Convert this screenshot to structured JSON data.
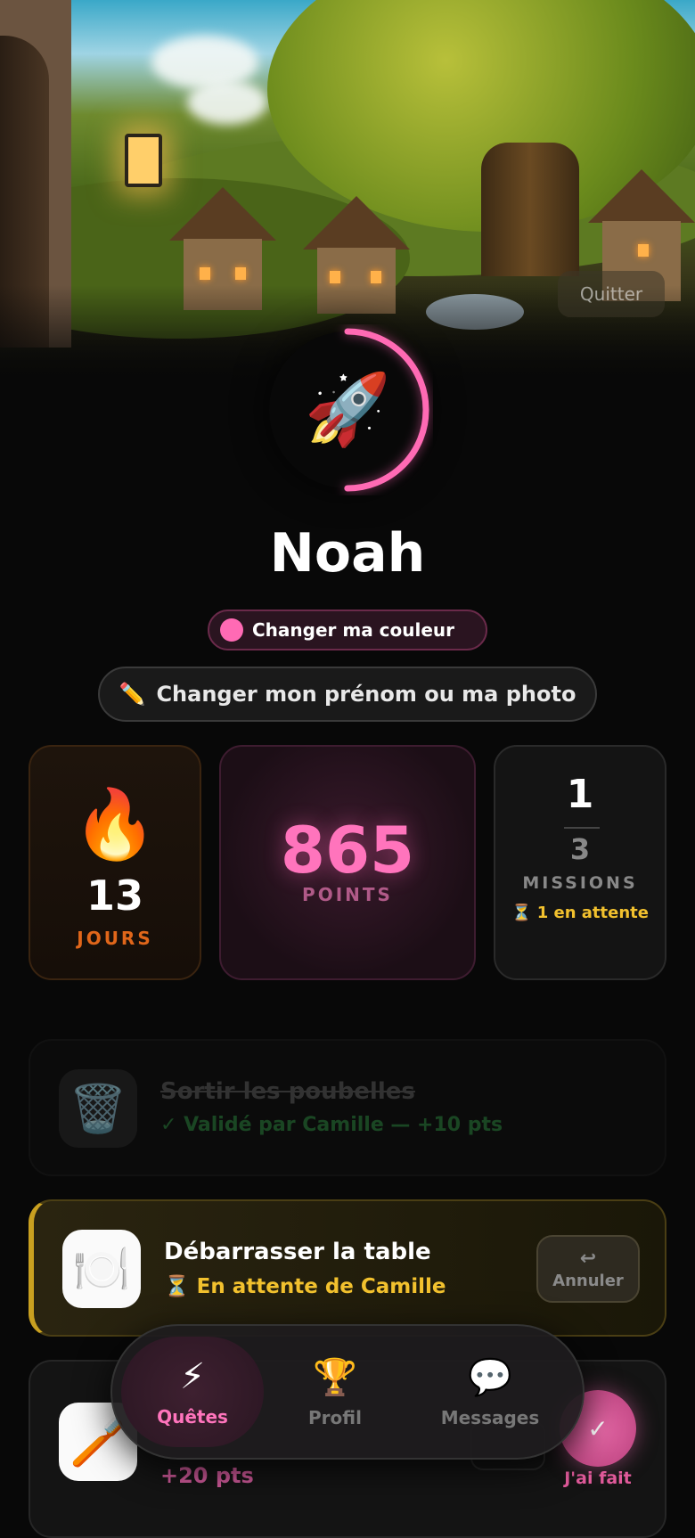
{
  "header": {
    "quit_label": "Quitter"
  },
  "profile": {
    "avatar_emoji": "🚀",
    "name": "Noah",
    "color_button_label": "Changer ma couleur",
    "accent_color": "#ff6ab4",
    "edit_icon": "✏️",
    "edit_button_label": "Changer mon prénom ou ma photo",
    "progress_ring_fraction": 0.5
  },
  "stats": {
    "streak": {
      "icon": "🔥",
      "value": "13",
      "label": "JOURS"
    },
    "points": {
      "value": "865",
      "label": "POINTS"
    },
    "missions": {
      "done": "1",
      "total": "3",
      "label": "MISSIONS",
      "pending_icon": "⏳",
      "pending_text": "1 en attente"
    }
  },
  "quests": [
    {
      "icon": "🗑️",
      "title": "Sortir les poubelles",
      "status": "✓ Validé par Camille — +10 pts",
      "state": "validated"
    },
    {
      "icon": "🍽️",
      "title": "Débarrasser la table",
      "status_icon": "⏳",
      "status": "En attente de Camille",
      "state": "pending",
      "undo_icon": "↩",
      "undo_label": "Annuler"
    },
    {
      "icon": "🪥",
      "points": "+20 pts",
      "state": "todo",
      "done_icon": "✓",
      "done_label": "J'ai fait"
    }
  ],
  "nav": [
    {
      "icon": "⚡",
      "label": "Quêtes",
      "active": true
    },
    {
      "icon": "🏆",
      "label": "Profil",
      "active": false
    },
    {
      "icon": "💬",
      "label": "Messages",
      "active": false
    }
  ]
}
